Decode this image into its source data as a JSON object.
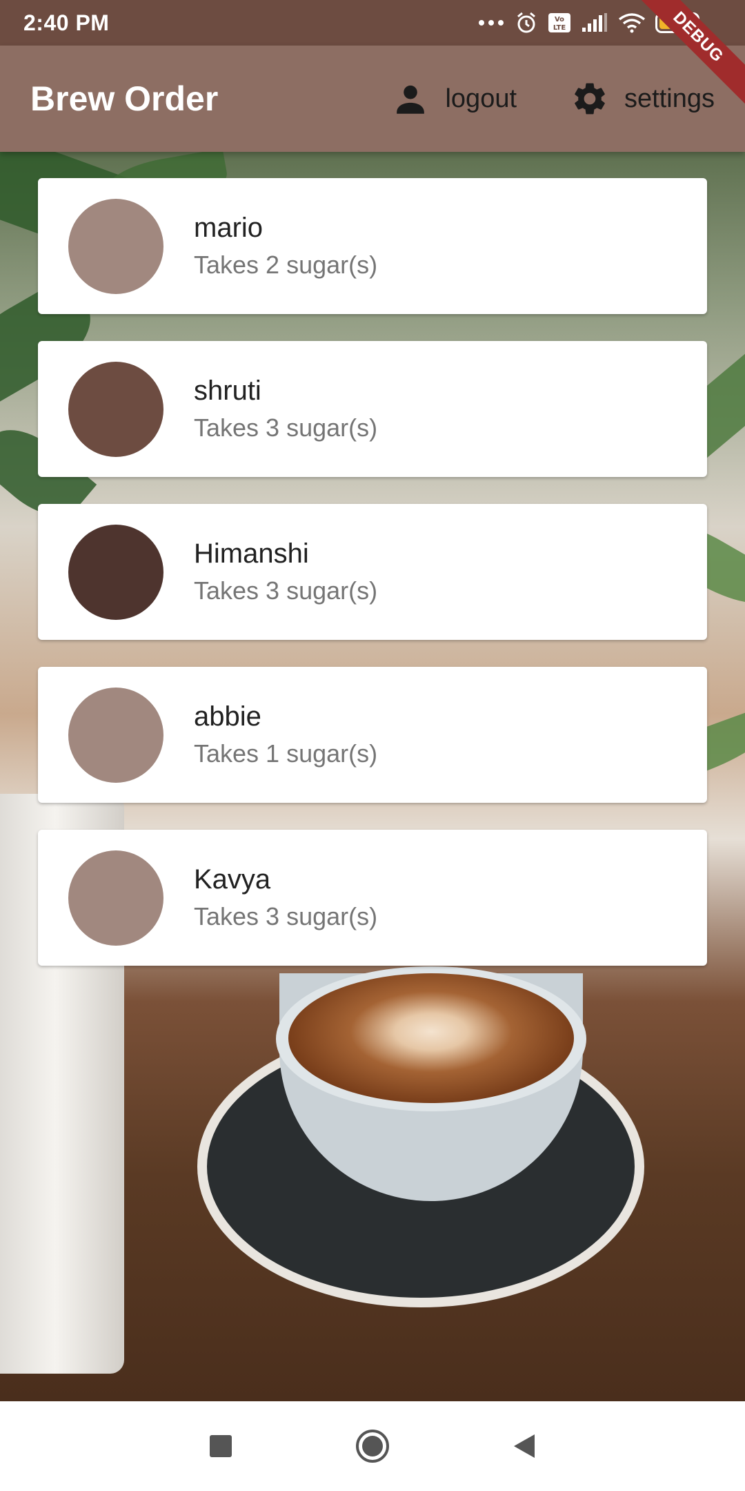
{
  "status_bar": {
    "time": "2:40 PM",
    "icons": [
      "more-dots-icon",
      "alarm-icon",
      "volte-icon",
      "signal-icon",
      "wifi-icon",
      "battery-icon"
    ],
    "volte_label": "Vo LTE",
    "battery_level": "42",
    "battery_fraction": 0.42,
    "debug_label": "DEBUG"
  },
  "app_bar": {
    "title": "Brew Order",
    "logout_label": "logout",
    "settings_label": "settings"
  },
  "colors": {
    "status_bar": "#6d4c41",
    "app_bar": "#8d6e63",
    "text_primary": "#212121",
    "text_secondary": "#757575"
  },
  "brews": [
    {
      "name": "mario",
      "subtitle": "Takes 2 sugar(s)",
      "avatar_color": "#a1887f"
    },
    {
      "name": "shruti",
      "subtitle": "Takes 3 sugar(s)",
      "avatar_color": "#6d4c41"
    },
    {
      "name": "Himanshi",
      "subtitle": "Takes 3 sugar(s)",
      "avatar_color": "#4e342e"
    },
    {
      "name": "abbie",
      "subtitle": "Takes 1 sugar(s)",
      "avatar_color": "#a1887f"
    },
    {
      "name": "Kavya",
      "subtitle": "Takes 3 sugar(s)",
      "avatar_color": "#a1887f"
    }
  ],
  "nav_bar": {
    "buttons": [
      "recents-square-icon",
      "home-circle-icon",
      "back-triangle-icon"
    ]
  }
}
